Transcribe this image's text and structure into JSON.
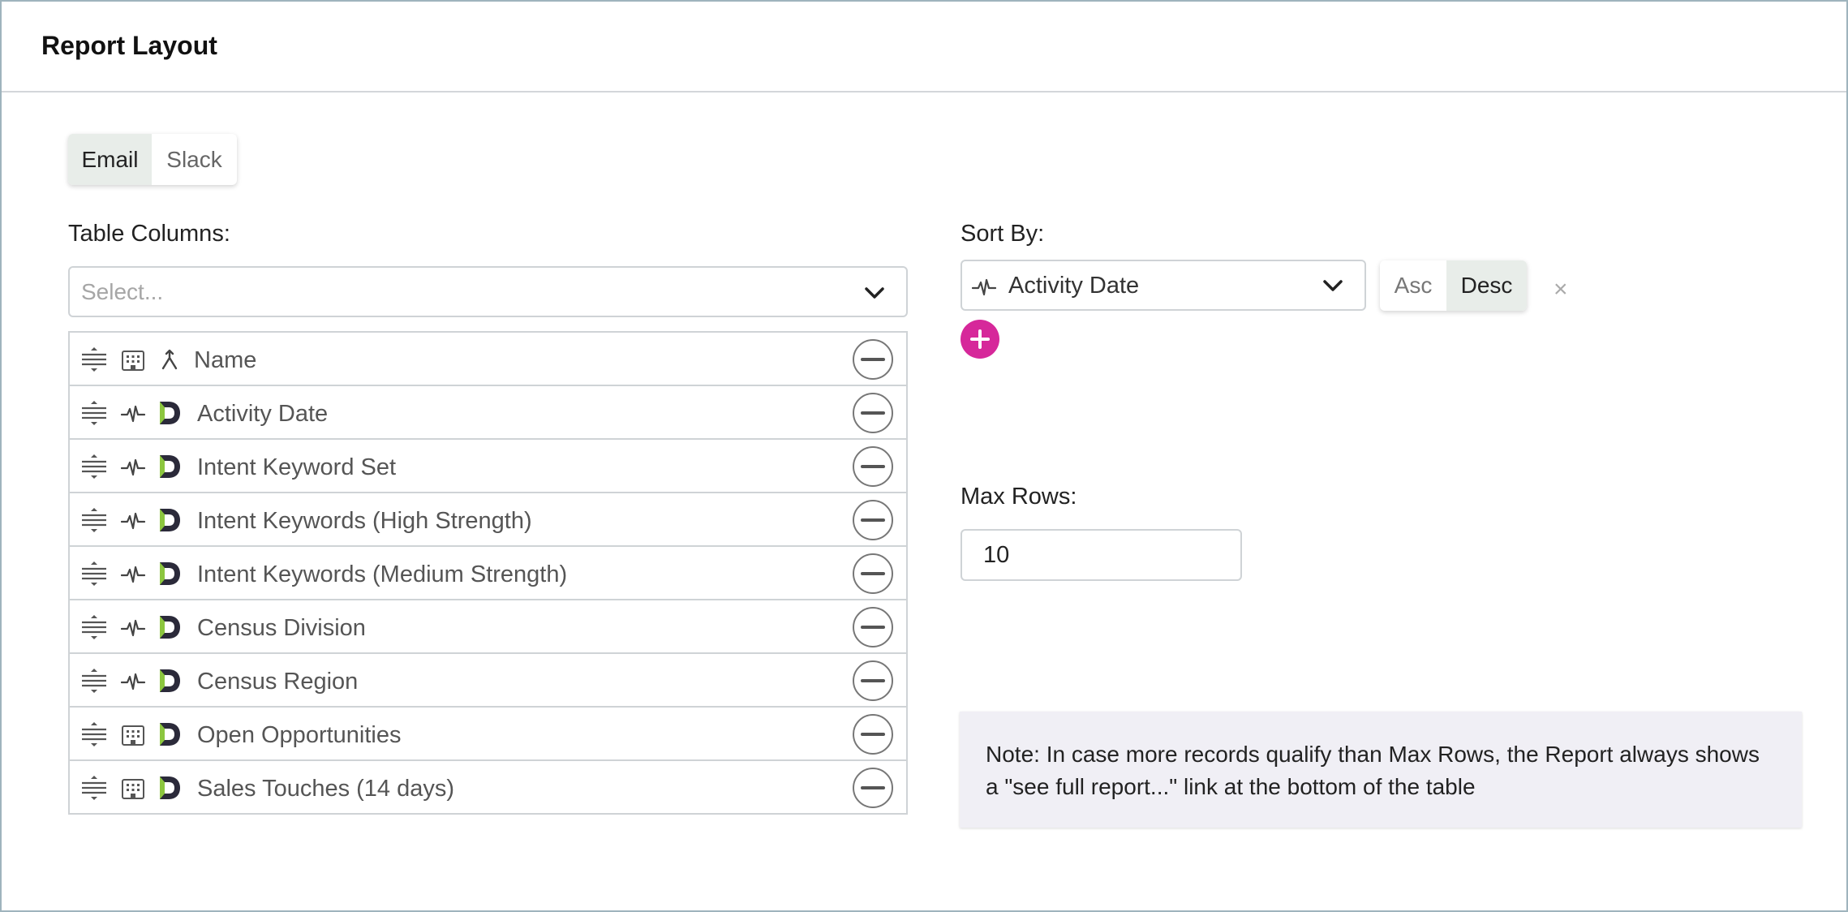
{
  "header": {
    "title": "Report Layout"
  },
  "channels": {
    "email": "Email",
    "slack": "Slack",
    "selected": "Email"
  },
  "columns_section": {
    "label": "Table Columns:",
    "select_placeholder": "Select...",
    "items": [
      {
        "name": "Name",
        "kind_icon": "building-icon",
        "source_icon": "merge-icon"
      },
      {
        "name": "Activity Date",
        "kind_icon": "activity-pulse-icon",
        "source_icon": "d-logo-icon"
      },
      {
        "name": "Intent Keyword Set",
        "kind_icon": "activity-pulse-icon",
        "source_icon": "d-logo-icon"
      },
      {
        "name": "Intent Keywords (High Strength)",
        "kind_icon": "activity-pulse-icon",
        "source_icon": "d-logo-icon"
      },
      {
        "name": "Intent Keywords (Medium Strength)",
        "kind_icon": "activity-pulse-icon",
        "source_icon": "d-logo-icon"
      },
      {
        "name": "Census Division",
        "kind_icon": "activity-pulse-icon",
        "source_icon": "d-logo-icon"
      },
      {
        "name": "Census Region",
        "kind_icon": "activity-pulse-icon",
        "source_icon": "d-logo-icon"
      },
      {
        "name": "Open Opportunities",
        "kind_icon": "building-icon",
        "source_icon": "d-logo-icon"
      },
      {
        "name": "Sales Touches (14 days)",
        "kind_icon": "building-icon",
        "source_icon": "d-logo-icon"
      }
    ]
  },
  "sort": {
    "label": "Sort By:",
    "value": "Activity Date",
    "asc_label": "Asc",
    "desc_label": "Desc",
    "direction": "Desc",
    "clear_label": "×"
  },
  "max_rows": {
    "label": "Max Rows:",
    "value": "10"
  },
  "note": {
    "text": "Note: In case more records qualify than Max Rows, the Report always shows a \"see full report...\" link at the bottom of the table"
  },
  "colors": {
    "accent": "#d6289a",
    "selected_toggle": "#e8ede9",
    "note_bg": "#f0eff5",
    "logo_dark": "#2b2a3a",
    "logo_green": "#8cc63f"
  }
}
